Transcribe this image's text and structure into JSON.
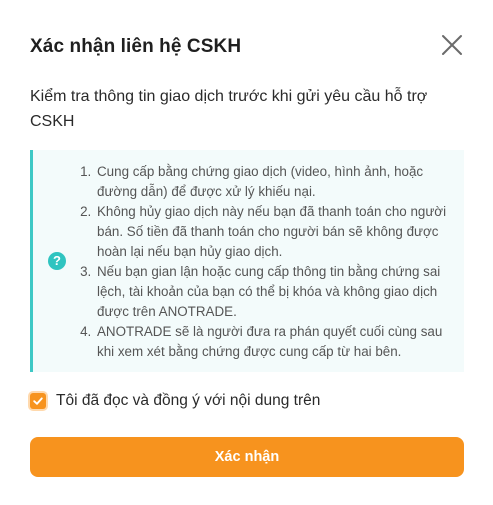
{
  "dialog": {
    "title": "Xác nhận liên hệ CSKH",
    "description": "Kiểm tra thông tin giao dịch trước khi gửi yêu cầu hỗ trợ CSKH",
    "close_icon": "close-icon"
  },
  "notice": {
    "icon": "question-icon",
    "icon_glyph": "?",
    "items": [
      "Cung cấp bằng chứng giao dịch (video, hình ảnh, hoặc đường dẫn) để được xử lý khiếu nại.",
      "Không hủy giao dịch này nếu bạn đã thanh toán cho người bán. Số tiền đã thanh toán cho người bán sẽ không được hoàn lại nếu bạn hủy giao dịch.",
      "Nếu bạn gian lận hoặc cung cấp thông tin bằng chứng sai lệch, tài khoản của bạn có thể bị khóa và không giao dịch được trên ANOTRADE.",
      "ANOTRADE sẽ là người đưa ra phán quyết cuối cùng sau khi xem xét bằng chứng được cung cấp từ hai bên."
    ]
  },
  "agreement": {
    "label": "Tôi đã đọc và đồng ý với nội dung trên",
    "checked": true
  },
  "actions": {
    "confirm_label": "Xác nhận"
  },
  "colors": {
    "accent": "#f7931e",
    "notice_border": "#3ec8c5",
    "notice_bg": "#f3fbfb"
  }
}
